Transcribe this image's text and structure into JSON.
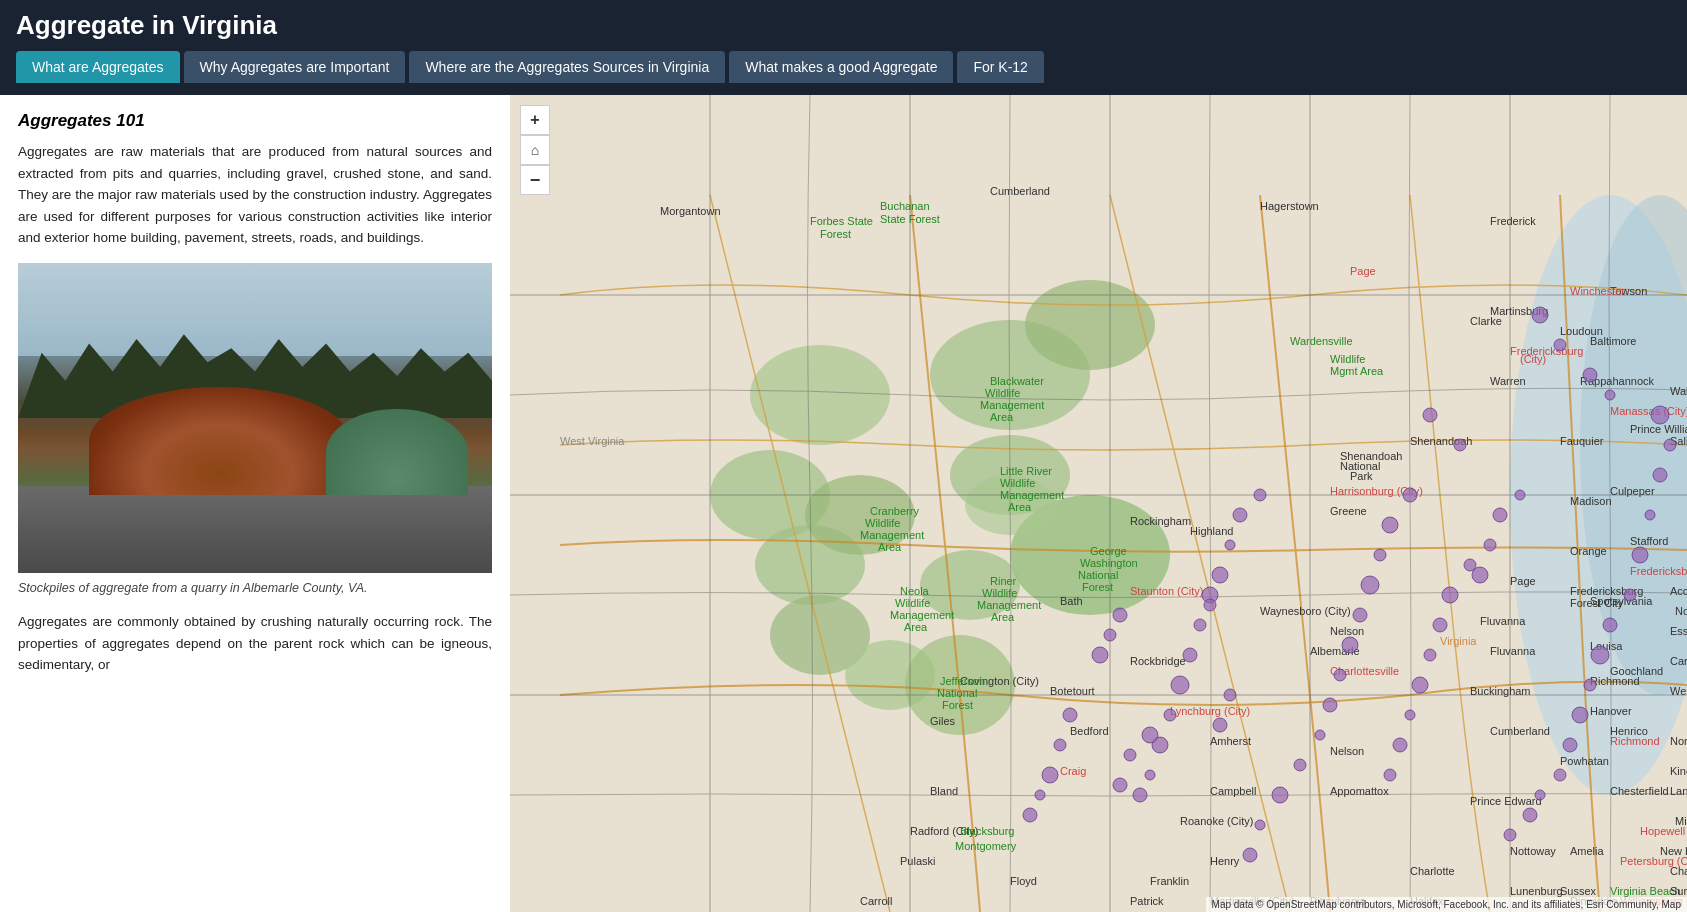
{
  "app": {
    "title": "Aggregate in Virginia"
  },
  "tabs": [
    {
      "id": "what-are-aggregates",
      "label": "What are Aggregates",
      "active": true
    },
    {
      "id": "why-important",
      "label": "Why Aggregates are Important",
      "active": false
    },
    {
      "id": "where-sources",
      "label": "Where are the Aggregates Sources in Virginia",
      "active": false
    },
    {
      "id": "what-makes-good",
      "label": "What makes a good Aggregate",
      "active": false
    },
    {
      "id": "for-k12",
      "label": "For K-12",
      "active": false
    }
  ],
  "left_panel": {
    "section_title": "Aggregates 101",
    "description_1": "Aggregates are raw materials that are produced from natural sources and extracted from pits and quarries, including gravel, crushed stone, and sand. They are the major raw materials used by the construction industry. Aggregates are used for different purposes for various construction activities like interior and exterior home building, pavement, streets, roads, and buildings.",
    "image_caption": "Stockpiles of aggregate from a quarry in Albemarle County, VA.",
    "description_2": "Aggregates are commonly obtained by crushing naturally occurring rock. The properties of aggregates depend on the parent rock which can be igneous, sedimentary, or"
  },
  "map": {
    "zoom_in_label": "+",
    "home_label": "⌂",
    "zoom_out_label": "−",
    "attribution": "Map data © OpenStreetMap contributors, Microsoft, Facebook, Inc. and its affiliates, Esri Community, Map"
  }
}
